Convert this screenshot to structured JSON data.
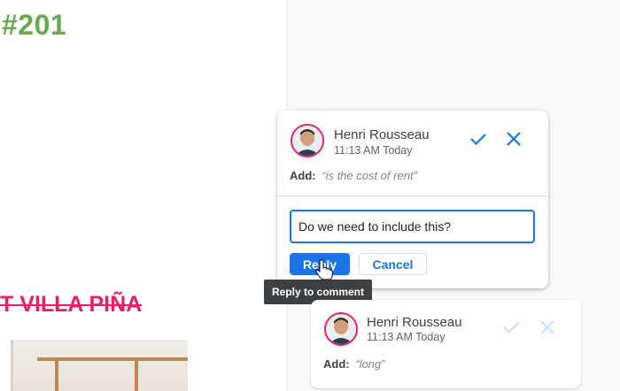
{
  "document": {
    "heading": "#201",
    "struck_title": "UT VILLA PIÑA"
  },
  "active_comment": {
    "author": "Henri Rousseau",
    "time": "11:13 AM Today",
    "suggestion_label": "Add:",
    "suggestion_value": "“is the cost of rent”",
    "reply_value": "Do we need to include this?",
    "reply_button": "Reply",
    "cancel_button": "Cancel",
    "tooltip": "Reply to comment"
  },
  "second_comment": {
    "author": "Henri Rousseau",
    "time": "11:13 AM Today",
    "suggestion_label": "Add:",
    "suggestion_value": "“long”"
  },
  "colors": {
    "accent": "#1a73e8",
    "heading_green": "#6aa84f",
    "struck_pink": "#e91e63",
    "avatar_ring": "#e91e63",
    "tooltip_bg": "#3c4043"
  },
  "icons": {
    "accept": "check-icon",
    "reject": "close-icon",
    "avatar": "person-avatar",
    "cursor": "hand-pointer-cursor"
  }
}
